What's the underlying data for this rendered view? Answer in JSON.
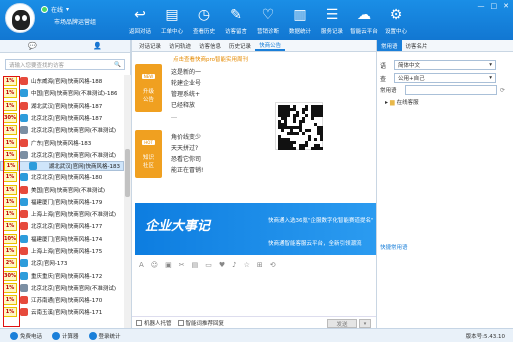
{
  "header": {
    "status": "在线",
    "org": "市场品牌运营组"
  },
  "nav": [
    {
      "label": "返回对话",
      "icon": "back-icon"
    },
    {
      "label": "工单中心",
      "icon": "ticket-icon"
    },
    {
      "label": "查看历史",
      "icon": "history-icon"
    },
    {
      "label": "访客留言",
      "icon": "message-icon"
    },
    {
      "label": "营销诊断",
      "icon": "diagnosis-icon"
    },
    {
      "label": "数据统计",
      "icon": "chart-icon"
    },
    {
      "label": "服务记录",
      "icon": "record-icon"
    },
    {
      "label": "智能云平台",
      "icon": "cloud-icon"
    },
    {
      "label": "设置中心",
      "icon": "gear-icon"
    }
  ],
  "left": {
    "search_placeholder": "请输入您要查找的访客",
    "rows": [
      {
        "badge": "1%",
        "name": "山东威海|官网|快商风格-188",
        "color": "#e64a3c"
      },
      {
        "badge": "1%",
        "name": "中国|官网|快商官网(不准测试)-186",
        "color": "#2d9cdb"
      },
      {
        "badge": "1%",
        "name": "湖北武汉|官网|快商风格-187",
        "color": "#e64a3c"
      },
      {
        "badge": "30%",
        "name": "北京北京|官网|快商风格-187",
        "color": "#2d9cdb"
      },
      {
        "badge": "1%",
        "name": "北京北京|官网|快商官网(不准测试)",
        "color": "#7b8fa3"
      },
      {
        "badge": "1%",
        "name": "广东|官网|快商风格-183",
        "color": "#e64a3c"
      },
      {
        "badge": "1%",
        "name": "北京北京|官网|快商官网(不准测试)",
        "color": "#7b8fa3"
      },
      {
        "badge": "1%",
        "name": "湖北武汉|官网|快商风格-183",
        "color": "#2d9cdb"
      },
      {
        "badge": "1%",
        "name": "北京北京|官网|快商风格-180",
        "color": "#2d9cdb"
      },
      {
        "badge": "1%",
        "name": "美国|官网|快商官网(不准测试)",
        "color": "#e64a3c"
      },
      {
        "badge": "1%",
        "name": "福建厦门|官网|快商风格-179",
        "color": "#2d9cdb"
      },
      {
        "badge": "1%",
        "name": "上海上海|官网|快商官网(不准测试)",
        "color": "#e64a3c"
      },
      {
        "badge": "1%",
        "name": "北京北京|官网|快商风格-177",
        "color": "#e64a3c"
      },
      {
        "badge": "10%",
        "name": "福建厦门|官网|快商风格-174",
        "color": "#2d9cdb"
      },
      {
        "badge": "1%",
        "name": "上海上海|官网|快商风格-175",
        "color": "#e64a3c"
      },
      {
        "badge": "2%",
        "name": "北京|官网-173",
        "color": "#2d9cdb"
      },
      {
        "badge": "30%",
        "name": "重庆重庆|官网|快商风格-172",
        "color": "#2d9cdb"
      },
      {
        "badge": "1%",
        "name": "北京北京|官网|快商官网(不准测试)",
        "color": "#7b8fa3"
      },
      {
        "badge": "1%",
        "name": "江苏南通|官网|快商风格-170",
        "color": "#e64a3c"
      },
      {
        "badge": "1%",
        "name": "云南玉溪|官网|快商风格-171",
        "color": "#e64a3c"
      }
    ]
  },
  "mid": {
    "tabs": [
      "对话记录",
      "访问轨迹",
      "访客信息",
      "历史记录",
      "快商公告"
    ],
    "news_head": "点击查看快商pro智能实用周刊",
    "tile1": {
      "label": "NEW",
      "text1": "升级",
      "text2": "公告"
    },
    "tile2": {
      "label": "HOT",
      "text1": "知识",
      "text2": "社区"
    },
    "news1": [
      "这是新的一",
      "轮建企业号",
      "管理系统+",
      "已经释放",
      "…"
    ],
    "news2": [
      "角价线变少",
      "天天拼过?",
      "恐看它你司",
      "能正在冒销!"
    ],
    "banner_big": "企业大事记",
    "banner_t1": "快商通入选36氪\"企服数字化智能赛道提名\"",
    "banner_t2": "快商通智能客服云平台，全新引领潮流",
    "robot": "机器人托管",
    "smart": "智能词推荐回复",
    "send": "发送"
  },
  "right": {
    "tabs": [
      "常用语",
      "访客名片"
    ],
    "lang_label": "语",
    "lang_val": "简体中文",
    "scope_label": "查",
    "scope_val": "公用+自己",
    "common_label": "常用语",
    "folder": "在线客服",
    "quick": "快捷常用语"
  },
  "bottom": {
    "items": [
      "免费电话",
      "计算器",
      "登录统计"
    ],
    "version": "版本号:5.43.10"
  }
}
